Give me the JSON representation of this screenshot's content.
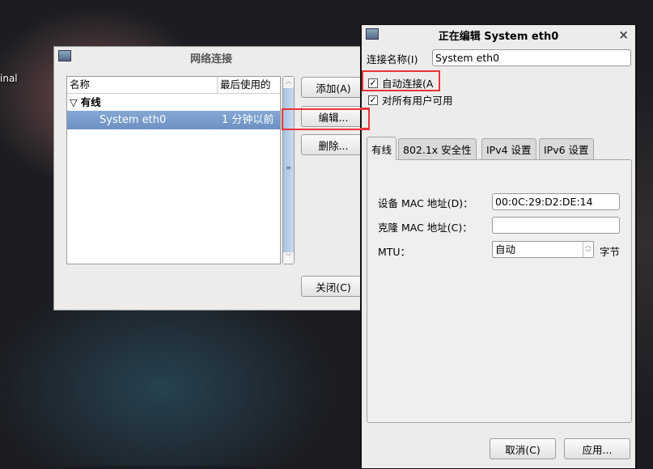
{
  "desktop": {
    "label": "inal"
  },
  "network_window": {
    "title": "网络连接",
    "columns": [
      "名称",
      "最后使用的"
    ],
    "group": "有线",
    "rows": [
      {
        "name": "System eth0",
        "last_used": "1 分钟以前"
      }
    ],
    "buttons": {
      "add": "添加(A)",
      "edit": "编辑...",
      "delete": "删除...",
      "close": "关闭(C)"
    }
  },
  "edit_window": {
    "title": "正在编辑 System eth0",
    "close_glyph": "×",
    "conn_name_label": "连接名称(I)",
    "conn_name_value": "System eth0",
    "auto_connect": {
      "label": "自动连接(A",
      "checked": true
    },
    "all_users": {
      "label": "对所有用户可用",
      "checked": true
    },
    "tabs": [
      "有线",
      "802.1x 安全性",
      "IPv4 设置",
      "IPv6 设置"
    ],
    "active_tab": "有线",
    "device_mac_label": "设备 MAC 地址(D)：",
    "device_mac_value": "00:0C:29:D2:DE:14",
    "clone_mac_label": "克隆 MAC 地址(C)：",
    "clone_mac_value": "",
    "mtu_label": "MTU：",
    "mtu_value": "自动",
    "mtu_unit": "字节",
    "buttons": {
      "cancel": "取消(C)",
      "apply": "应用..."
    }
  },
  "colors": {
    "highlight": "#e83535",
    "selection": "#7397c6"
  }
}
